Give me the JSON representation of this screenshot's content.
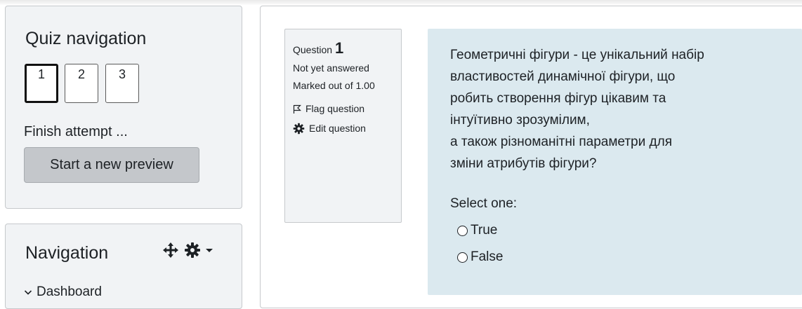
{
  "quiz_nav": {
    "title": "Quiz navigation",
    "buttons": [
      "1",
      "2",
      "3"
    ],
    "finish_label": "Finish attempt ...",
    "preview_button": "Start a new preview"
  },
  "navigation": {
    "title": "Navigation",
    "controls": [
      "move-icon",
      "gear-icon",
      "caret-down-icon"
    ],
    "items": [
      {
        "label": "Dashboard"
      }
    ]
  },
  "question": {
    "prefix": "Question",
    "number": "1",
    "status": "Not yet answered",
    "marked": "Marked out of 1.00",
    "flag": "Flag question",
    "edit": "Edit question",
    "text_lines": [
      "Геометричні фігури - це унікальний набір",
      "властивостей динамічної фігури, що",
      "робить створення фігур цікавим та",
      "інтуїтивно зрозумілим,",
      "а також різноманітні параметри для",
      "зміни атрибутів фігури?"
    ],
    "select_label": "Select one:",
    "options": [
      "True",
      "False"
    ],
    "selected": null
  },
  "colors": {
    "block_bg": "#f1f3f5",
    "content_bg": "#dbe9ef",
    "button_bg": "#c4c7cb",
    "text": "#1d2125"
  }
}
